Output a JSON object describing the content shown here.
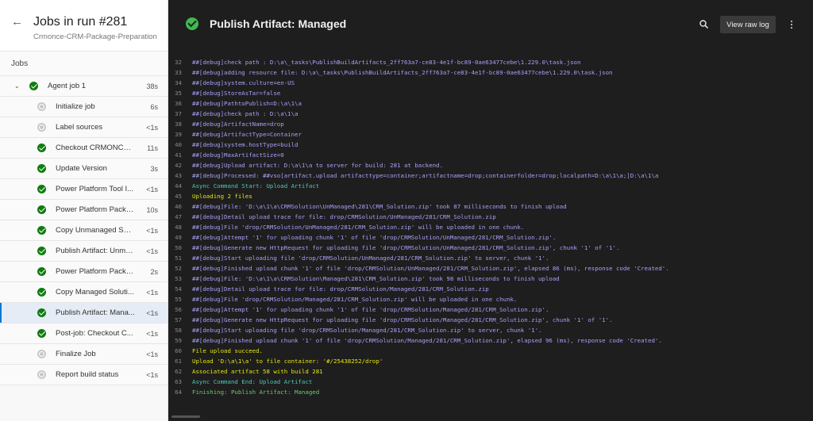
{
  "header": {
    "back_icon": "arrow-left-icon",
    "title": "Jobs in run #281",
    "subtitle": "Crmonce-CRM-Package-Preparation"
  },
  "jobs_label": "Jobs",
  "job": {
    "label": "Agent job 1",
    "duration": "38s",
    "status": "success"
  },
  "steps": [
    {
      "label": "Initialize job",
      "duration": "6s",
      "status": "skipped"
    },
    {
      "label": "Label sources",
      "duration": "<1s",
      "status": "skipped"
    },
    {
      "label": "Checkout CRMONCE ...",
      "duration": "11s",
      "status": "success"
    },
    {
      "label": "Update Version",
      "duration": "3s",
      "status": "success"
    },
    {
      "label": "Power Platform Tool I...",
      "duration": "<1s",
      "status": "success"
    },
    {
      "label": "Power Platform Pack S...",
      "duration": "10s",
      "status": "success"
    },
    {
      "label": "Copy Unmanaged Sol...",
      "duration": "<1s",
      "status": "success"
    },
    {
      "label": "Publish Artifact: Unma...",
      "duration": "<1s",
      "status": "success"
    },
    {
      "label": "Power Platform Pack So...",
      "duration": "2s",
      "status": "success"
    },
    {
      "label": "Copy Managed Soluti...",
      "duration": "<1s",
      "status": "success"
    },
    {
      "label": "Publish Artifact: Mana...",
      "duration": "<1s",
      "status": "success",
      "selected": true
    },
    {
      "label": "Post-job: Checkout C...",
      "duration": "<1s",
      "status": "success"
    },
    {
      "label": "Finalize Job",
      "duration": "<1s",
      "status": "skipped"
    },
    {
      "label": "Report build status",
      "duration": "<1s",
      "status": "skipped"
    }
  ],
  "main": {
    "title": "Publish Artifact: Managed",
    "search_icon": "search-icon",
    "view_raw_label": "View raw log",
    "more_icon": "more-vertical-icon"
  },
  "colors": {
    "success": "#107c10",
    "skipped": "#c8c8c8",
    "log_debug": "#a8a0f8",
    "log_section": "#4ec9b0",
    "log_highlight": "#e5e510"
  },
  "log_lines": [
    {
      "n": "32",
      "t": "##[debug]check path : D:\\a\\_tasks\\PublishBuildArtifacts_2ff763a7-ce83-4e1f-bc89-0ae63477cebe\\1.229.0\\task.json",
      "c": ""
    },
    {
      "n": "33",
      "t": "##[debug]adding resource file: D:\\a\\_tasks\\PublishBuildArtifacts_2ff763a7-ce83-4e1f-bc89-0ae63477cebe\\1.229.0\\task.json",
      "c": ""
    },
    {
      "n": "34",
      "t": "##[debug]system.culture=en-US",
      "c": ""
    },
    {
      "n": "35",
      "t": "##[debug]StoreAsTar=false",
      "c": ""
    },
    {
      "n": "36",
      "t": "##[debug]PathtoPublish=D:\\a\\1\\a",
      "c": ""
    },
    {
      "n": "37",
      "t": "##[debug]check path : D:\\a\\1\\a",
      "c": ""
    },
    {
      "n": "38",
      "t": "##[debug]ArtifactName=drop",
      "c": ""
    },
    {
      "n": "39",
      "t": "##[debug]ArtifactType=Container",
      "c": ""
    },
    {
      "n": "40",
      "t": "##[debug]system.hostType=build",
      "c": ""
    },
    {
      "n": "41",
      "t": "##[debug]MaxArtifactSize=0",
      "c": ""
    },
    {
      "n": "42",
      "t": "##[debug]Upload artifact: D:\\a\\1\\a to server for build: 281 at backend.",
      "c": ""
    },
    {
      "n": "43",
      "t": "##[debug]Processed: ##vso[artifact.upload artifacttype=container;artifactname=drop;containerfolder=drop;localpath=D:\\a\\1\\a;]D:\\a\\1\\a",
      "c": ""
    },
    {
      "n": "44",
      "t": "Async Command Start: Upload Artifact",
      "c": "green"
    },
    {
      "n": "45",
      "t": "Uploading 2 files",
      "c": "yellow"
    },
    {
      "n": "46",
      "t": "##[debug]File: 'D:\\a\\1\\a\\CRMSolution\\UnManaged\\281\\CRM_Solution.zip' took 87 milliseconds to finish upload",
      "c": ""
    },
    {
      "n": "47",
      "t": "##[debug]Detail upload trace for file: drop/CRMSolution/UnManaged/281/CRM_Solution.zip",
      "c": ""
    },
    {
      "n": "48",
      "t": "##[debug]File 'drop/CRMSolution/UnManaged/281/CRM_Solution.zip' will be uploaded in one chunk.",
      "c": ""
    },
    {
      "n": "49",
      "t": "##[debug]Attempt '1' for uploading chunk '1' of file 'drop/CRMSolution/UnManaged/281/CRM_Solution.zip'.",
      "c": ""
    },
    {
      "n": "50",
      "t": "##[debug]Generate new HttpRequest for uploading file 'drop/CRMSolution/UnManaged/281/CRM_Solution.zip', chunk '1' of '1'.",
      "c": ""
    },
    {
      "n": "51",
      "t": "##[debug]Start uploading file 'drop/CRMSolution/UnManaged/281/CRM_Solution.zip' to server, chunk '1'.",
      "c": ""
    },
    {
      "n": "52",
      "t": "##[debug]Finished upload chunk '1' of file 'drop/CRMSolution/UnManaged/281/CRM_Solution.zip', elapsed 86 (ms), response code 'Created'.",
      "c": ""
    },
    {
      "n": "53",
      "t": "##[debug]File: 'D:\\a\\1\\a\\CRMSolution\\Managed\\281\\CRM_Solution.zip' took 98 milliseconds to finish upload",
      "c": ""
    },
    {
      "n": "54",
      "t": "##[debug]Detail upload trace for file: drop/CRMSolution/Managed/281/CRM_Solution.zip",
      "c": ""
    },
    {
      "n": "55",
      "t": "##[debug]File 'drop/CRMSolution/Managed/281/CRM_Solution.zip' will be uploaded in one chunk.",
      "c": ""
    },
    {
      "n": "56",
      "t": "##[debug]Attempt '1' for uploading chunk '1' of file 'drop/CRMSolution/Managed/281/CRM_Solution.zip'.",
      "c": ""
    },
    {
      "n": "57",
      "t": "##[debug]Generate new HttpRequest for uploading file 'drop/CRMSolution/Managed/281/CRM_Solution.zip', chunk '1' of '1'.",
      "c": ""
    },
    {
      "n": "58",
      "t": "##[debug]Start uploading file 'drop/CRMSolution/Managed/281/CRM_Solution.zip' to server, chunk '1'.",
      "c": ""
    },
    {
      "n": "59",
      "t": "##[debug]Finished upload chunk '1' of file 'drop/CRMSolution/Managed/281/CRM_Solution.zip', elapsed 96 (ms), response code 'Created'.",
      "c": ""
    },
    {
      "n": "60",
      "t": "File upload succeed.",
      "c": "yellow"
    },
    {
      "n": "61",
      "t": "Upload 'D:\\a\\1\\a' to file container: '#/25438252/drop'",
      "c": "yellow"
    },
    {
      "n": "62",
      "t": "Associated artifact 58 with build 281",
      "c": "yellow"
    },
    {
      "n": "63",
      "t": "Async Command End: Upload Artifact",
      "c": "green"
    },
    {
      "n": "64",
      "t": "Finishing: Publish Artifact: Managed",
      "c": "green2"
    }
  ]
}
